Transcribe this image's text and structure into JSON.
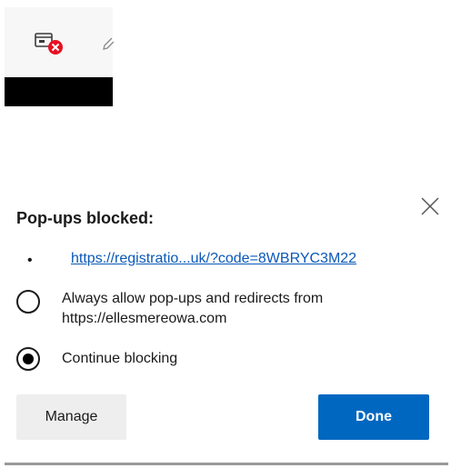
{
  "toolbar": {
    "popup_indicator_icon": "popup-blocked-icon",
    "partial_icon": "pen-icon"
  },
  "popup": {
    "title": "Pop-ups blocked:",
    "bullet": "•",
    "blocked_link": "https://registratio...uk/?code=8WBRYC3M22",
    "options": [
      {
        "label_line1": "Always allow pop-ups and redirects from",
        "label_line2": "https://ellesmereowa.com",
        "selected": false
      },
      {
        "label_line1": "Continue blocking",
        "label_line2": "",
        "selected": true
      }
    ],
    "manage_label": "Manage",
    "done_label": "Done"
  },
  "colors": {
    "accent": "#0067c0",
    "link": "#0a58b8",
    "blocked_badge": "#e81123"
  }
}
